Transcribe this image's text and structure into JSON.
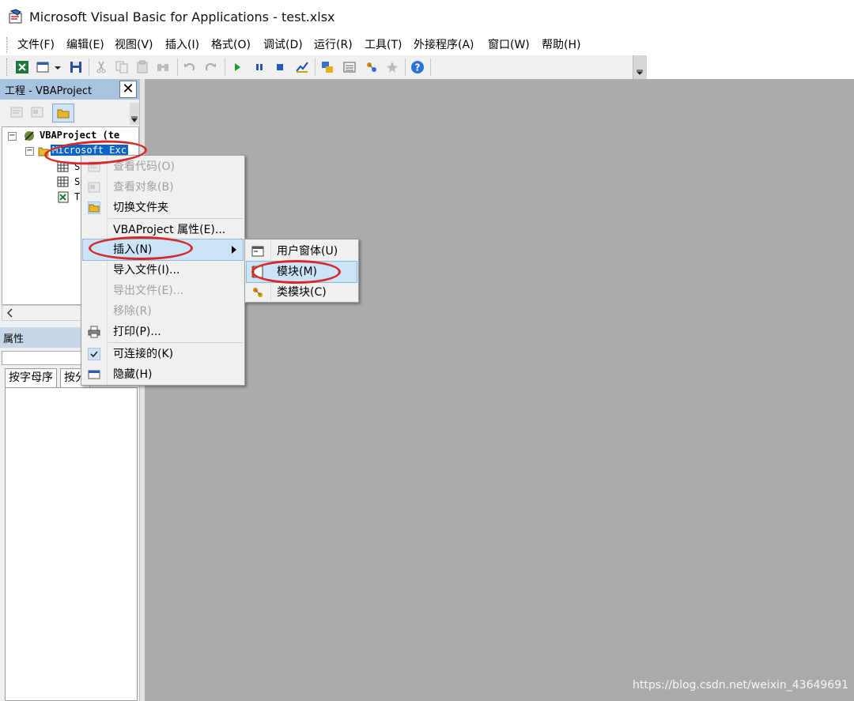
{
  "window": {
    "title": "Microsoft Visual Basic for Applications - test.xlsx"
  },
  "menubar": [
    "文件(F)",
    "编辑(E)",
    "视图(V)",
    "插入(I)",
    "格式(O)",
    "调试(D)",
    "运行(R)",
    "工具(T)",
    "外接程序(A)",
    "窗口(W)",
    "帮助(H)"
  ],
  "toolbar": {
    "icons": [
      "excel-icon",
      "insert-userform-icon",
      "dropdown-arrow-icon",
      "save-icon",
      "cut-icon",
      "copy-icon",
      "paste-icon",
      "find-icon",
      "undo-icon",
      "redo-icon",
      "run-icon",
      "break-icon",
      "reset-icon",
      "design-mode-icon",
      "project-explorer-icon",
      "properties-window-icon",
      "object-browser-icon",
      "toolbox-icon",
      "help-icon"
    ]
  },
  "project_panel": {
    "title": "工程 - VBAProject",
    "close": "✕",
    "tree": {
      "root": "VBAProject (te",
      "folder": "Microsoft Exc",
      "children": [
        "S",
        "S",
        "T"
      ],
      "expand_symbols": [
        "⊟",
        "⊟"
      ]
    }
  },
  "properties_panel": {
    "title": "属性",
    "tabs": [
      "按字母序",
      "按分"
    ]
  },
  "context_menu": {
    "items": [
      {
        "label": "查看代码(O)",
        "disabled": true,
        "icon": "view-code-icon"
      },
      {
        "label": "查看对象(B)",
        "disabled": true,
        "icon": "view-object-icon"
      },
      {
        "label": "切换文件夹",
        "disabled": false,
        "icon": "folder-icon"
      },
      {
        "label": "VBAProject 属性(E)...",
        "disabled": false,
        "icon": ""
      },
      {
        "label": "插入(N)",
        "disabled": false,
        "icon": "",
        "submenu": true,
        "highlighted": true
      },
      {
        "label": "导入文件(I)...",
        "disabled": false,
        "icon": ""
      },
      {
        "label": "导出文件(E)...",
        "disabled": true,
        "icon": ""
      },
      {
        "label": "移除(R)",
        "disabled": true,
        "icon": ""
      },
      {
        "label": "打印(P)...",
        "disabled": false,
        "icon": "printer-icon"
      },
      {
        "label": "可连接的(K)",
        "disabled": false,
        "icon": "checkmark-icon"
      },
      {
        "label": "隐藏(H)",
        "disabled": false,
        "icon": "hide-icon"
      }
    ]
  },
  "submenu": {
    "items": [
      {
        "label": "用户窗体(U)",
        "icon": "userform-icon"
      },
      {
        "label": "模块(M)",
        "icon": "module-icon",
        "highlighted": true
      },
      {
        "label": "类模块(C)",
        "icon": "class-module-icon"
      }
    ]
  },
  "watermark": "https://blog.csdn.net/weixin_43649691",
  "colors": {
    "annotation_ring": "#d42a2a",
    "menu_highlight": "#cce4f7",
    "workspace": "#ababab",
    "tree_selection": "#0a64c8"
  }
}
